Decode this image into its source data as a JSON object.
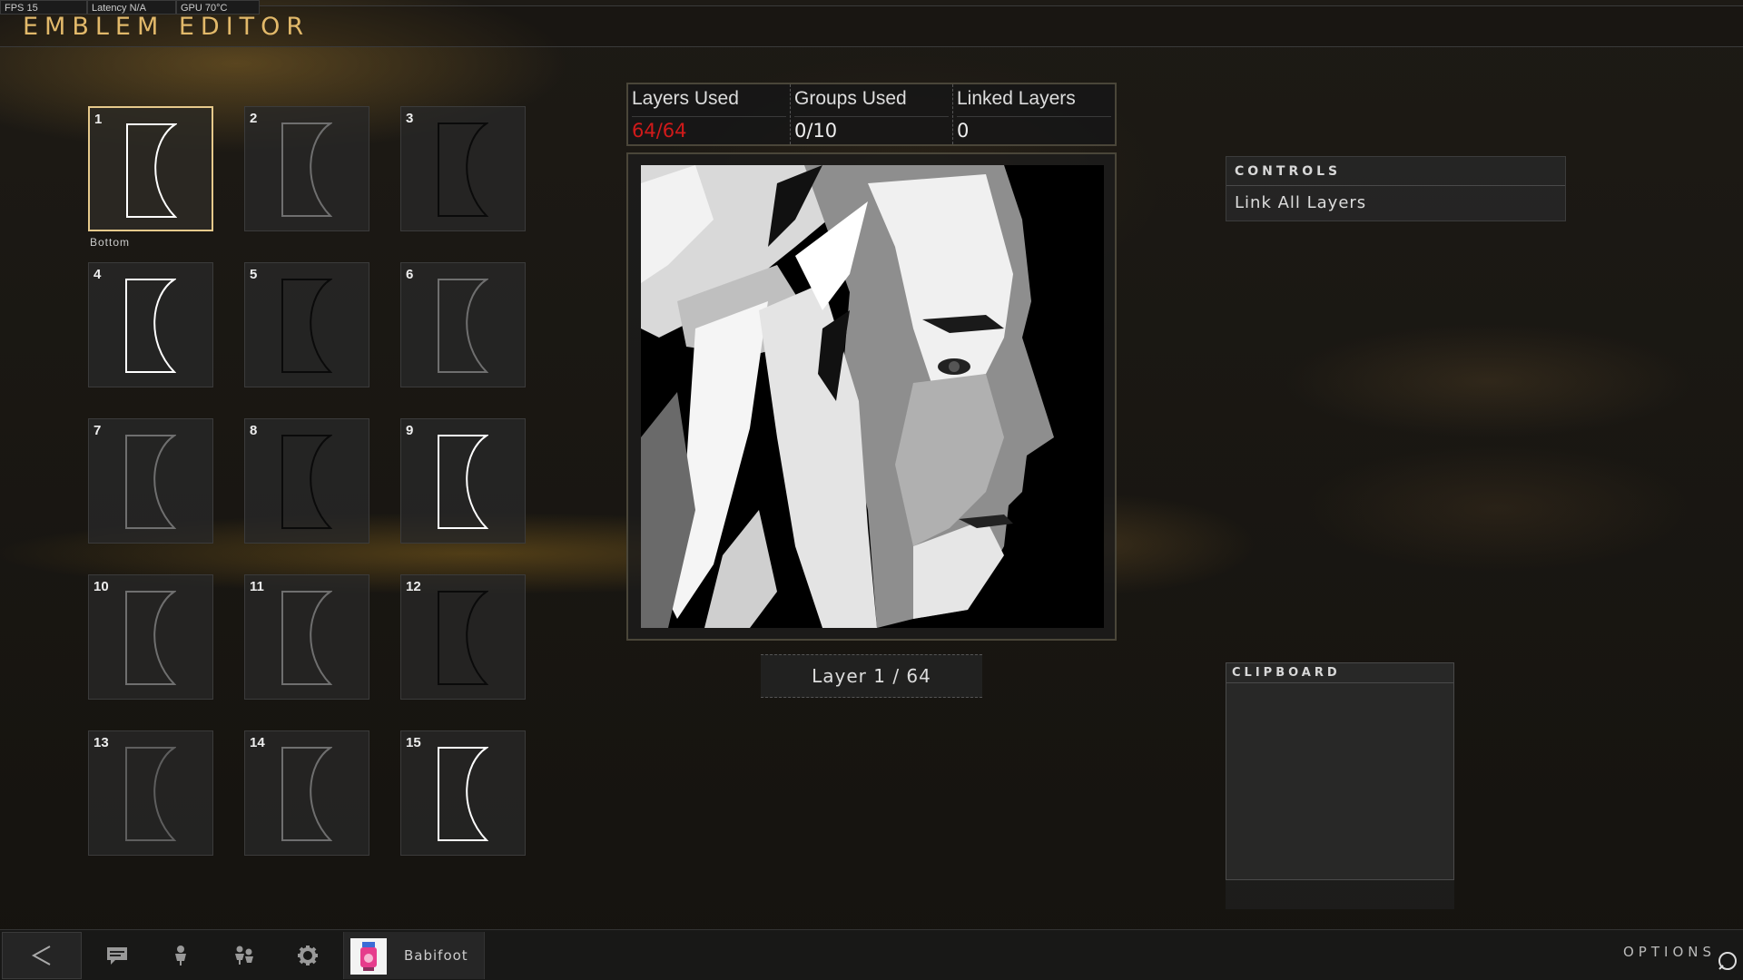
{
  "perf": {
    "fps": "FPS 15",
    "latency": "Latency N/A",
    "gpu": "GPU 70°C"
  },
  "header": {
    "title": "EMBLEM EDITOR"
  },
  "layers": {
    "selected": 1,
    "selected_caption": "Bottom",
    "tiles": [
      {
        "num": "1",
        "stroke": "#ffffff"
      },
      {
        "num": "2",
        "stroke": "#6f6f6f"
      },
      {
        "num": "3",
        "stroke": "#0a0a0a"
      },
      {
        "num": "4",
        "stroke": "#ffffff"
      },
      {
        "num": "5",
        "stroke": "#0a0a0a"
      },
      {
        "num": "6",
        "stroke": "#6f6f6f"
      },
      {
        "num": "7",
        "stroke": "#6f6f6f"
      },
      {
        "num": "8",
        "stroke": "#0a0a0a"
      },
      {
        "num": "9",
        "stroke": "#ffffff"
      },
      {
        "num": "10",
        "stroke": "#6f6f6f"
      },
      {
        "num": "11",
        "stroke": "#6f6f6f"
      },
      {
        "num": "12",
        "stroke": "#0a0a0a"
      },
      {
        "num": "13",
        "stroke": "#5e5e5e"
      },
      {
        "num": "14",
        "stroke": "#6f6f6f"
      },
      {
        "num": "15",
        "stroke": "#ffffff"
      }
    ]
  },
  "stats": {
    "layers_used_label": "Layers Used",
    "layers_used_value": "64/64",
    "groups_used_label": "Groups Used",
    "groups_used_value": "0/10",
    "linked_layers_label": "Linked Layers",
    "linked_layers_value": "0"
  },
  "emblem": {
    "layer_indicator": "Layer 1 / 64"
  },
  "controls": {
    "header": "CONTROLS",
    "items": [
      "Link All Layers"
    ]
  },
  "clipboard": {
    "header": "CLIPBOARD"
  },
  "footer": {
    "icons": [
      "back-arrow-icon",
      "chat-icon",
      "player-icon",
      "party-icon",
      "gear-icon"
    ],
    "gamertag": "Babifoot",
    "options_label": "OPTIONS"
  },
  "colors": {
    "accent": "#e2b96a",
    "selected_border": "#e6c98b",
    "warning": "#d11a1a"
  }
}
